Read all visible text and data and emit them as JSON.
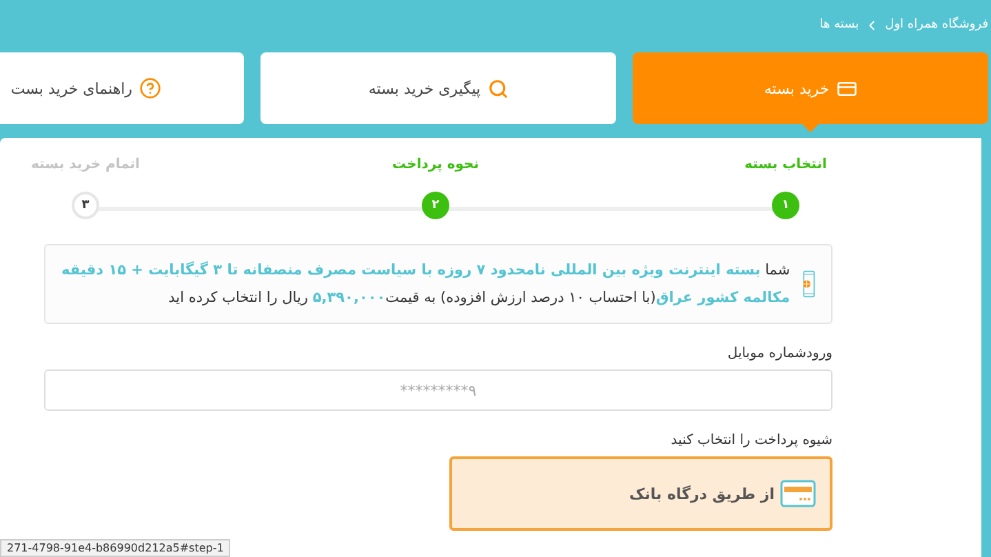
{
  "breadcrumb": [
    {
      "label": "فروشگاه همراه اول"
    },
    {
      "label": "بسته ها"
    }
  ],
  "tabs": [
    {
      "label": "خرید بسته",
      "kind": "card",
      "selected": true
    },
    {
      "label": "پیگیری خرید بسته",
      "kind": "search",
      "selected": false
    },
    {
      "label": "راهنمای خرید بست",
      "kind": "help",
      "selected": false
    }
  ],
  "steps": [
    {
      "number": "۱",
      "label": "انتخاب بسته",
      "done": true
    },
    {
      "number": "۲",
      "label": "نحوه پرداخت",
      "done": true
    },
    {
      "number": "۳",
      "label": "اتمام خرید بسته",
      "done": false
    }
  ],
  "summary": {
    "text": "شما **بسته اینترنت ویژه بین المللی نامحدود ۷ روزه با سیاست مصرف منصفانه تا ۳ گیگابایت + ۱۵ دقیقه مکالمه کشور عراق**(با احتساب ۱۰ درصد ارزش افزوده) به قیمت**۵,۳۹۰,۰۰۰** ریال را انتخاب کرده اید"
  },
  "mobile": {
    "label": "ورودشماره موبایل",
    "placeholder": "۹*********"
  },
  "payment": {
    "label": "شیوه پرداخت را انتخاب کنید",
    "options": [
      {
        "label": "از طریق درگاه بانک",
        "selected": true
      }
    ]
  },
  "status_url": "271-4798-91e4-b86990d212a5#step-1"
}
